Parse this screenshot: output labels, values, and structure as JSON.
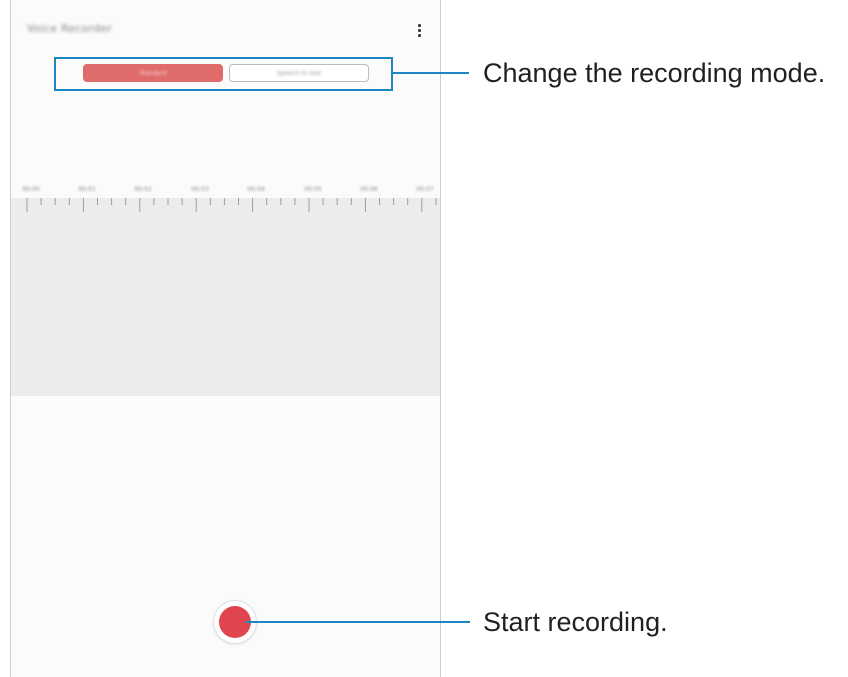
{
  "app": {
    "title": "Voice Recorder"
  },
  "menu": {
    "icon": "more-options-icon"
  },
  "mode_selector": {
    "modes": [
      {
        "label": "Standard",
        "selected": true
      },
      {
        "label": "Speech-to-text",
        "selected": false
      }
    ]
  },
  "timeline": {
    "labels": [
      "00:00",
      "00:01",
      "00:02",
      "00:03",
      "00:04",
      "00:05",
      "00:06",
      "00:07"
    ]
  },
  "record": {
    "icon": "record-icon",
    "color": "#e0454f"
  },
  "callouts": {
    "mode": "Change the recording mode.",
    "record": "Start recording."
  },
  "colors": {
    "accent_blue": "#1d87c2",
    "active_mode": "#e06b6b",
    "waveform_bg": "#ececec"
  }
}
